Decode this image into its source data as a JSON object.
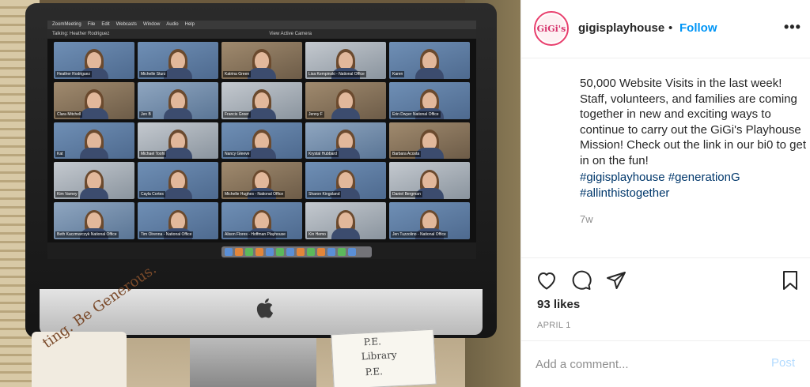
{
  "post": {
    "username": "gigisplayhouse",
    "separator": "•",
    "follow_label": "Follow",
    "more_label": "•••",
    "avatar_text": "GiGi's",
    "caption": "50,000 Website Visits in the last week! Staff, volunteers, and families are coming together in new and exciting ways to continue to carry out the GiGi's Playhouse Mission! Check out the link in our bi0 to get in on the fun!",
    "hashtags": "#gigisplayhouse #generationG #allinthistogether",
    "time_ago": "7w",
    "likes": "93 likes",
    "date": "APRIL 1",
    "comment_placeholder": "Add a comment...",
    "post_label": "Post"
  },
  "photo": {
    "zoom_title": "Talking: Heather Rodriguez",
    "zoom_view": "View Active Camera",
    "menu": [
      "ZoomMeeting",
      "File",
      "Edit",
      "Webcasts",
      "Window",
      "Audio",
      "Help"
    ],
    "mug_text": "ting. Be Generous.",
    "notebook_lines": [
      "P.E.",
      "Library",
      "P.E."
    ],
    "participants": [
      "Heather Rodriguez",
      "Michelle Sturz",
      "Katrina Green",
      "Lisa Kempinski - National Office",
      "Karen",
      "Clara Mitchell",
      "Jen B",
      "Francis Greer",
      "Jenny F",
      "Erin Dwyer National Office",
      "Kat",
      "Michael Toohi",
      "Nancy Gleeve",
      "Krystal Hubbard",
      "Barbara Acosta",
      "Kim Varney",
      "Cayla Cortes",
      "Michelle Hughes - National Office",
      "Sharon Kingsland",
      "Daniel Bergman",
      "Beth Kaczmarczyk National Office",
      "Tim Olrenna - National Office",
      "Alison Flores - Hoffman Playhouse",
      "Kin Hemo",
      "Jen Tuzzolino - National Office"
    ]
  },
  "colors": {
    "follow": "#0095f6",
    "hashtag": "#00376b",
    "muted": "#8e8e8e",
    "post_disabled": "#b3dbff"
  },
  "icons": [
    "heart-icon",
    "comment-icon",
    "share-icon",
    "bookmark-icon",
    "apple-logo-icon"
  ]
}
